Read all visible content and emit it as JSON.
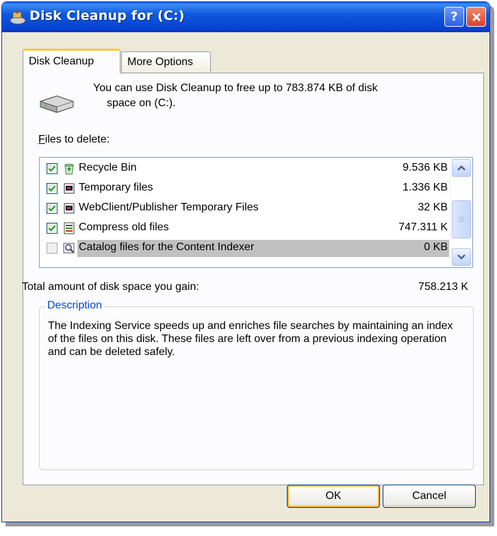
{
  "window": {
    "title": "Disk Cleanup for  (C:)",
    "help_glyph": "?",
    "accent": "#0a4fd6"
  },
  "tabs": [
    {
      "label": "Disk Cleanup",
      "active": true
    },
    {
      "label": "More Options",
      "active": false
    }
  ],
  "info": {
    "line1": "You can use Disk Cleanup to free up to 783.874 KB of disk",
    "line2": "space on  (C:)."
  },
  "files_label_prefix": "F",
  "files_label_rest": "iles to delete:",
  "files": [
    {
      "label": "Recycle Bin",
      "size": "9.536 KB",
      "checked": true,
      "icon": "recycle-bin-icon"
    },
    {
      "label": "Temporary files",
      "size": "1.336 KB",
      "checked": true,
      "icon": "temp-file-icon"
    },
    {
      "label": "WebClient/Publisher Temporary Files",
      "size": "32 KB",
      "checked": true,
      "icon": "temp-file-icon"
    },
    {
      "label": "Compress old files",
      "size": "747.311 K",
      "checked": true,
      "icon": "compress-icon"
    },
    {
      "label": "Catalog files for the Content Indexer",
      "size": "0 KB",
      "checked": false,
      "icon": "catalog-icon"
    }
  ],
  "total": {
    "label": "Total amount of disk space you gain:",
    "value": "758.213 K"
  },
  "description": {
    "title": "Description",
    "text": "The Indexing Service speeds up and enriches file searches by maintaining an index of the files on this disk. These files are left over from a previous indexing operation and can be deleted safely."
  },
  "buttons": {
    "ok": "OK",
    "cancel": "Cancel"
  }
}
